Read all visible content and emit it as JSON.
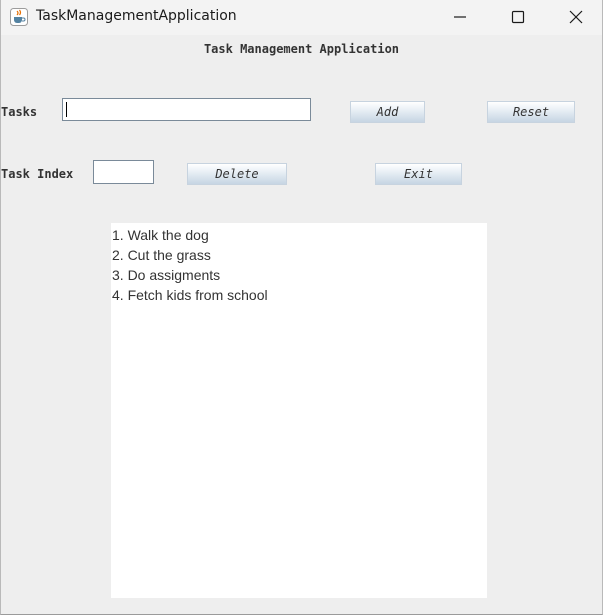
{
  "window": {
    "title": "TaskManagementApplication",
    "icon": "java-cup-icon",
    "controls": [
      "minimize-icon",
      "maximize-icon",
      "close-icon"
    ]
  },
  "heading": "Task Management Application",
  "tasks_row": {
    "label": "Tasks",
    "input_value": "",
    "add_label": "Add",
    "reset_label": "Reset"
  },
  "index_row": {
    "label": "Task Index",
    "input_value": "",
    "delete_label": "Delete",
    "exit_label": "Exit"
  },
  "task_list": [
    "1. Walk the dog",
    "2. Cut the grass",
    "3. Do assigments",
    "4. Fetch kids from school"
  ],
  "colors": {
    "background": "#eeeeee",
    "titlebar": "#f3f3f3",
    "text_area": "#ffffff",
    "button_gradient_top": "#ffffff",
    "button_gradient_bottom": "#c6d5e3"
  }
}
